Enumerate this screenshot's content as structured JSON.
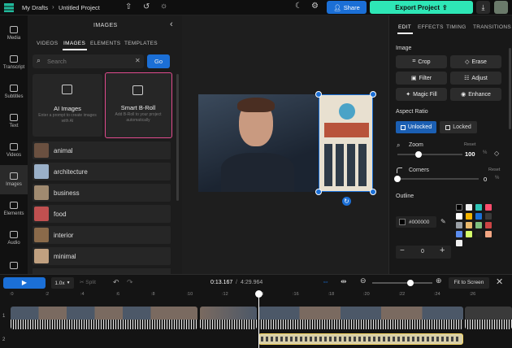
{
  "topbar": {
    "breadcrumb_root": "My Drafts",
    "separator": "›",
    "project_name": "Untitled Project",
    "share_label": "Share",
    "export_label": "Export Project"
  },
  "leftnav": [
    {
      "label": "Media",
      "icon": "media-icon"
    },
    {
      "label": "Transcript",
      "icon": "transcript-icon"
    },
    {
      "label": "Subtitles",
      "icon": "subtitles-icon"
    },
    {
      "label": "Text",
      "icon": "text-icon"
    },
    {
      "label": "Videos",
      "icon": "videos-icon"
    },
    {
      "label": "Images",
      "icon": "images-icon",
      "active": true
    },
    {
      "label": "Elements",
      "icon": "elements-icon"
    },
    {
      "label": "Audio",
      "icon": "audio-icon"
    }
  ],
  "panel": {
    "title": "IMAGES",
    "tabs": [
      "VIDEOS",
      "IMAGES",
      "ELEMENTS",
      "TEMPLATES"
    ],
    "active_tab": "IMAGES",
    "search_placeholder": "Search",
    "go_label": "Go",
    "cards": [
      {
        "title": "AI Images",
        "desc": "Enter a prompt to create images with AI"
      },
      {
        "title": "Smart B-Roll",
        "desc": "Add B-Roll to your project automatically"
      }
    ],
    "categories": [
      "animal",
      "architecture",
      "business",
      "food",
      "interior",
      "minimal"
    ]
  },
  "right": {
    "tabs": [
      "EDIT",
      "EFFECTS",
      "TIMING",
      "TRANSITIONS"
    ],
    "active_tab": "EDIT",
    "image_section": "Image",
    "buttons": [
      "Crop",
      "Erase",
      "Filter",
      "Adjust",
      "Magic Fill",
      "Enhance"
    ],
    "aspect_section": "Aspect Ratio",
    "aspect_options": [
      "Unlocked",
      "Locked"
    ],
    "aspect_selected": "Unlocked",
    "zoom_label": "Zoom",
    "zoom_value": "100",
    "zoom_unit": "%",
    "zoom_level": 0.32,
    "reset_label": "Reset",
    "corners_label": "Corners",
    "corners_value": "0",
    "corners_unit": "%",
    "corners_level": 0.0,
    "outline_section": "Outline",
    "outline_color": "#000000",
    "outline_width": "0",
    "swatches": [
      "#000000",
      "#f0f0f0",
      "#2ec4b6",
      "#ff4d6d",
      "#ffffff",
      "#f4b400",
      "#1b6fd6",
      "#3a3a3a",
      "#9aa0a6",
      "#e8b86d",
      "#7fbf7f",
      "#cc4444",
      "#5b8def",
      "#d4ff6a",
      "#1e1e1e",
      "#f3a683",
      "#f0f0f0"
    ]
  },
  "timeline": {
    "speed": "1.0x",
    "split_label": "Split",
    "time_current": "0:13.167",
    "time_total": "4:29.964",
    "fit_label": "Fit to Screen",
    "zoom_level": 0.64,
    "ticks": [
      ":0",
      ":2",
      ":4",
      ":6",
      ":8",
      ":10",
      ":12",
      ":14",
      ":16",
      ":18",
      ":20",
      ":22",
      ":24",
      ":26"
    ],
    "tracks": [
      "1",
      "2"
    ]
  }
}
